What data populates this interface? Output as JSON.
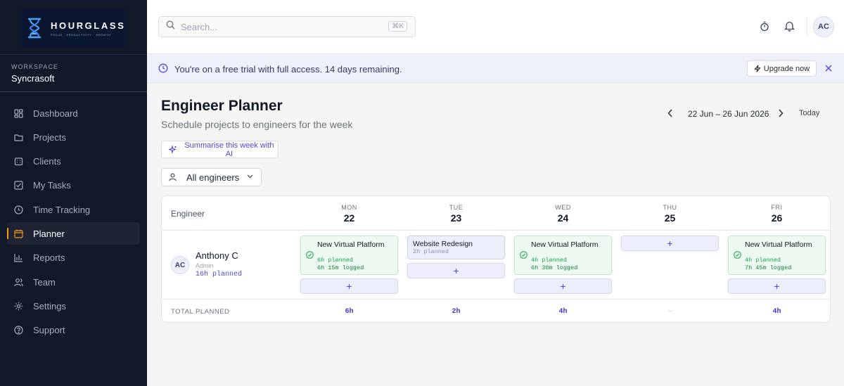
{
  "app": {
    "logo_name": "HOURGLASS",
    "logo_tags": [
      "FOCUS",
      "PRODUCTIVITY",
      "GROWTH"
    ],
    "brand_color": "#0b1730",
    "accent": "#4f46e5"
  },
  "sidebar": {
    "workspace_label": "WORKSPACE",
    "workspace_name": "Syncrasoft",
    "items": [
      {
        "label": "Dashboard",
        "icon": "dashboard-icon"
      },
      {
        "label": "Projects",
        "icon": "folder-icon"
      },
      {
        "label": "Clients",
        "icon": "building-icon"
      },
      {
        "label": "My Tasks",
        "icon": "checkbox-icon"
      },
      {
        "label": "Time Tracking",
        "icon": "clock-icon"
      },
      {
        "label": "Planner",
        "icon": "calendar-icon",
        "active": true
      },
      {
        "label": "Reports",
        "icon": "bar-chart-icon"
      },
      {
        "label": "Team",
        "icon": "users-icon"
      },
      {
        "label": "Settings",
        "icon": "gear-icon"
      },
      {
        "label": "Support",
        "icon": "help-icon"
      }
    ]
  },
  "topbar": {
    "search_placeholder": "Search...",
    "search_shortcut": "⌘K",
    "avatar_initials": "AC"
  },
  "banner": {
    "text": "You're on a free trial with full access. 14 days remaining.",
    "upgrade_label": "Upgrade now"
  },
  "page": {
    "title": "Engineer Planner",
    "subtitle": "Schedule projects to engineers for the week",
    "ai_button": "Summarise this week with AI",
    "engineer_filter": "All engineers",
    "week_range": "22 Jun – 26 Jun 2026",
    "today_label": "Today"
  },
  "table": {
    "engineer_header": "Engineer",
    "days": [
      {
        "dow": "MON",
        "date": "22"
      },
      {
        "dow": "TUE",
        "date": "23"
      },
      {
        "dow": "WED",
        "date": "24"
      },
      {
        "dow": "THU",
        "date": "25"
      },
      {
        "dow": "FRI",
        "date": "26"
      }
    ],
    "engineer": {
      "initials": "AC",
      "name": "Anthony C",
      "role": "Admin",
      "planned": "16h planned"
    },
    "tasks": {
      "mon": {
        "name": "New Virtual Platform",
        "planned": "6h planned",
        "logged": "6h 15m logged"
      },
      "tue": {
        "name": "Website Redesign",
        "planned": "2h planned"
      },
      "wed": {
        "name": "New Virtual Platform",
        "planned": "4h planned",
        "logged": "6h 30m logged"
      },
      "fri": {
        "name": "New Virtual Platform",
        "planned": "4h planned",
        "logged": "7h 45m logged"
      }
    },
    "add_label": "+",
    "total_label": "TOTAL PLANNED",
    "totals": [
      "6h",
      "2h",
      "4h",
      "—",
      "4h"
    ]
  }
}
